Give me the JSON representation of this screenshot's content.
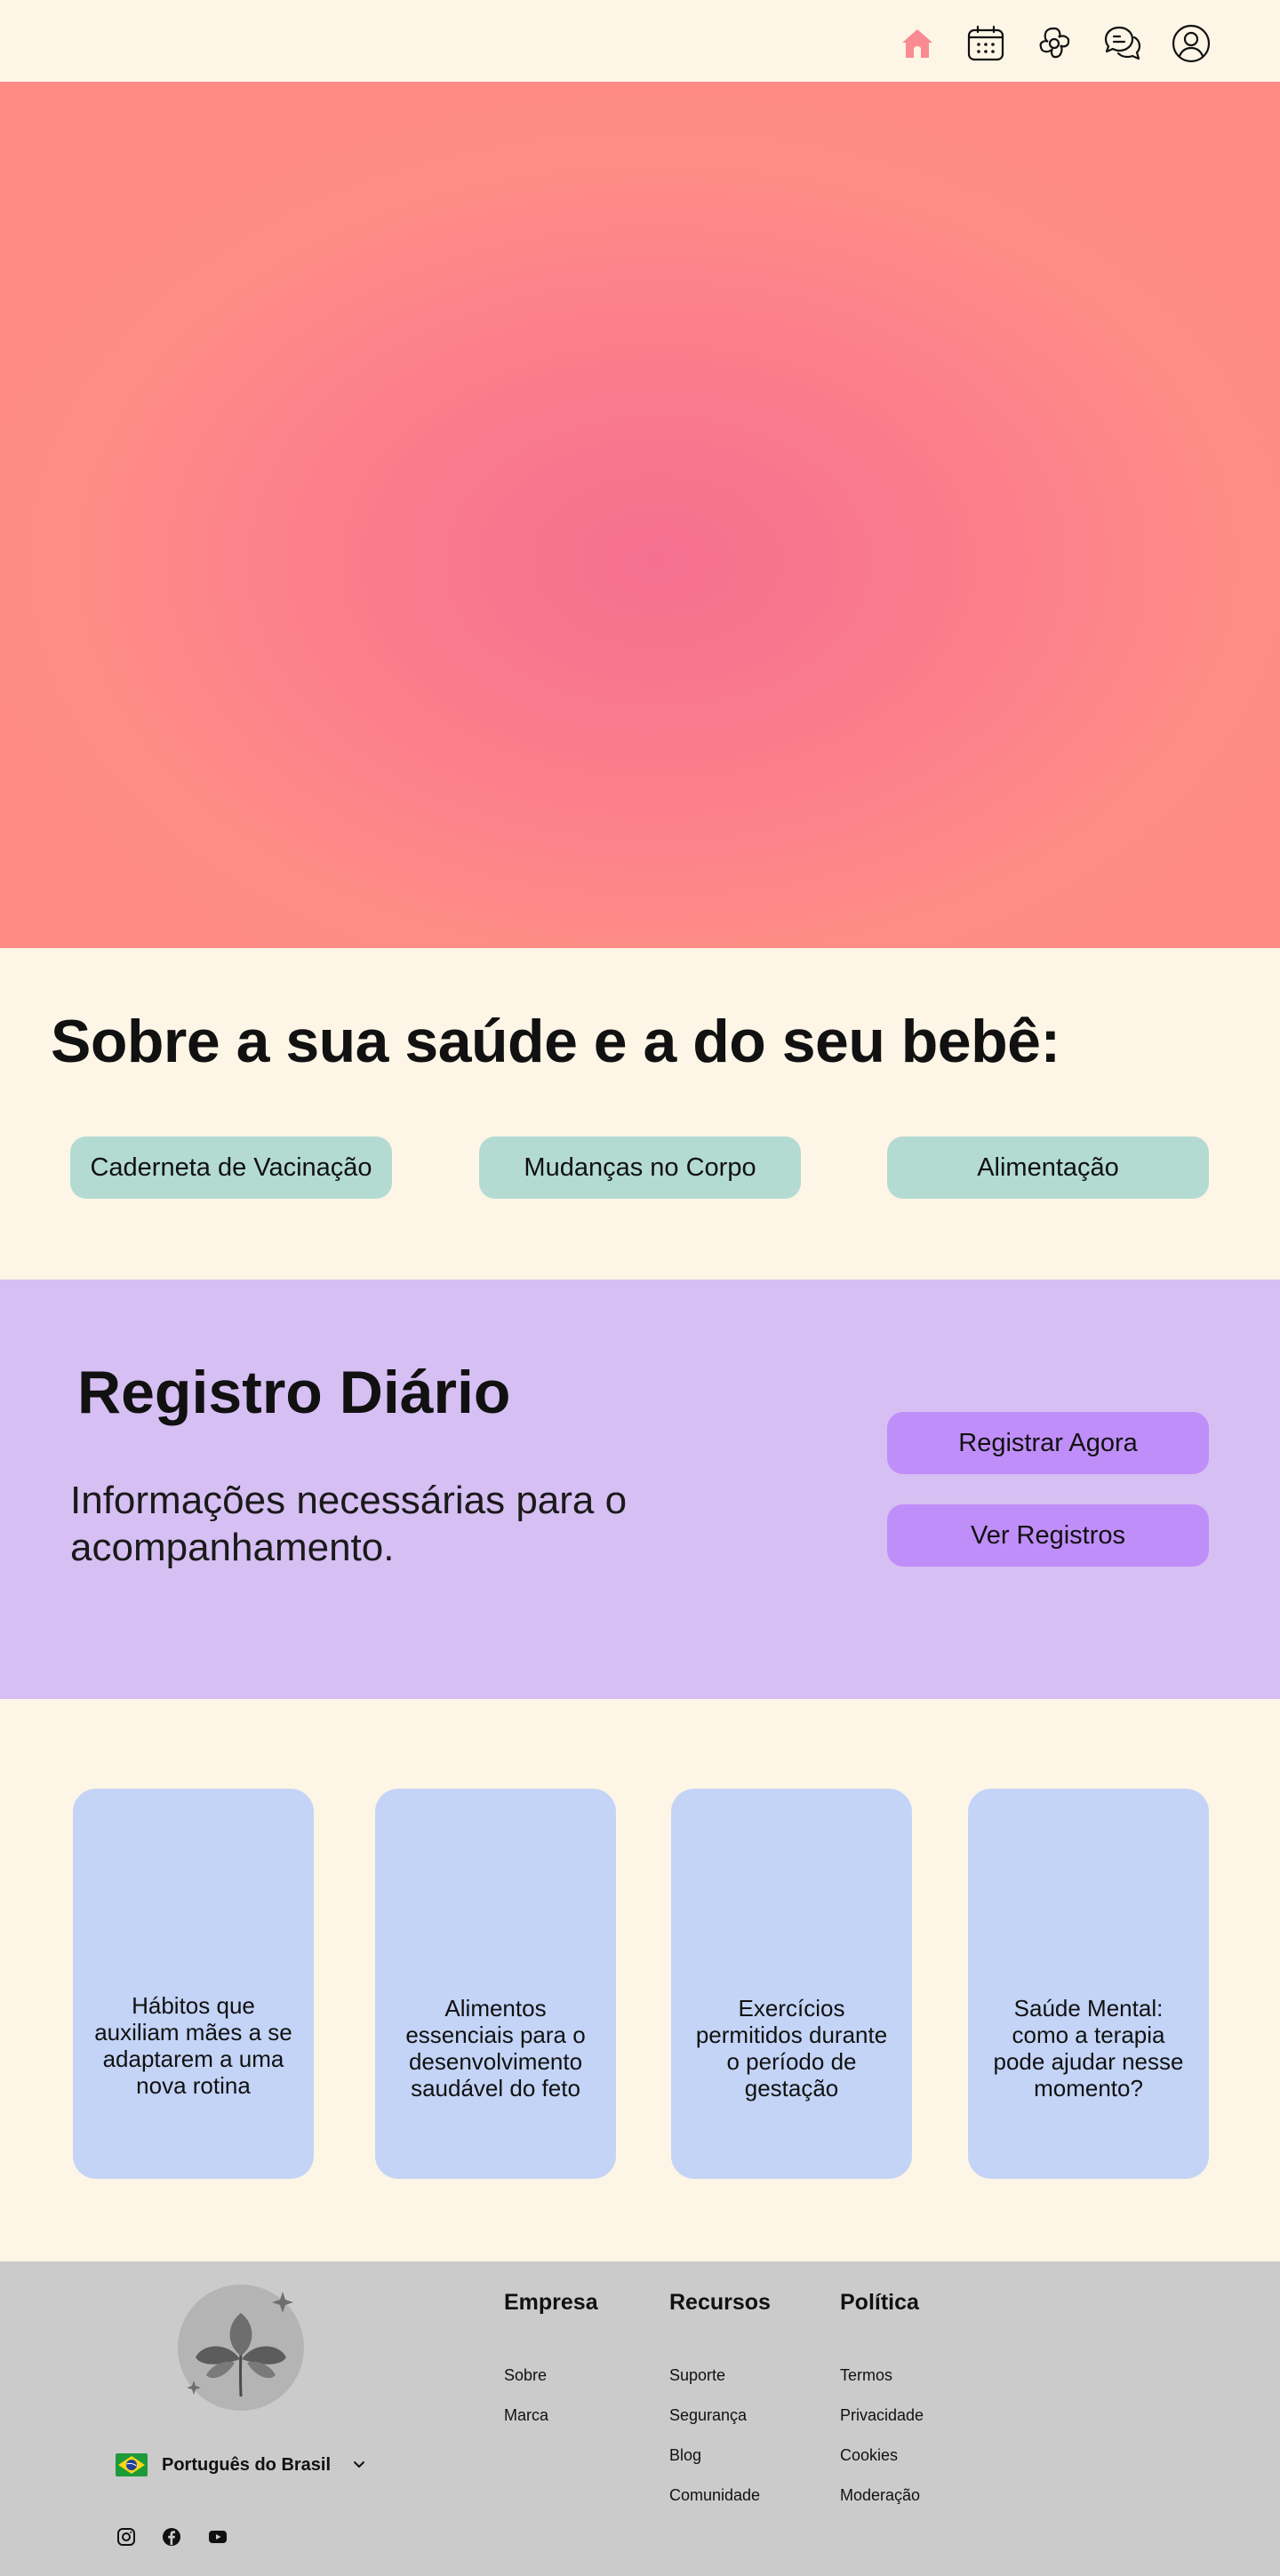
{
  "header": {
    "nav": [
      {
        "icon": "home-icon",
        "active": true,
        "color": "#fb8b92"
      },
      {
        "icon": "calendar-icon",
        "active": false
      },
      {
        "icon": "flower-icon",
        "active": false
      },
      {
        "icon": "chat-icon",
        "active": false
      },
      {
        "icon": "user-icon",
        "active": false
      }
    ]
  },
  "hero": {
    "colors": [
      "#f66f8f",
      "#fe8c85"
    ]
  },
  "about": {
    "title": "Sobre a sua saúde e a do seu bebê:",
    "topics": [
      "Caderneta de Vacinação",
      "Mudanças no Corpo",
      "Alimentação"
    ],
    "pill_color": "#b3dbd2"
  },
  "daily": {
    "title": "Registro Diário",
    "subtitle": "Informações necessárias para o acompanhamento.",
    "buttons": [
      "Registrar Agora",
      "Ver Registros"
    ],
    "background": "#d6bff3",
    "button_color": "#c08ef9"
  },
  "articles": [
    {
      "title": "Hábitos que auxiliam mães a se adaptarem a uma nova rotina"
    },
    {
      "title": "Alimentos essenciais para o desenvolvimento saudável do feto"
    },
    {
      "title": "Exercícios permitidos durante o período de gestação"
    },
    {
      "title": "Saúde Mental: como a terapia pode ajudar nesse momento?"
    }
  ],
  "footer": {
    "language": "Português do Brasil",
    "social": [
      "instagram-icon",
      "facebook-icon",
      "youtube-icon"
    ],
    "columns": [
      {
        "heading": "Empresa",
        "links": [
          "Sobre",
          "Marca"
        ]
      },
      {
        "heading": "Recursos",
        "links": [
          "Suporte",
          "Segurança",
          "Blog",
          "Comunidade"
        ]
      },
      {
        "heading": "Política",
        "links": [
          "Termos",
          "Privacidade",
          "Cookies",
          "Moderação"
        ]
      }
    ]
  }
}
